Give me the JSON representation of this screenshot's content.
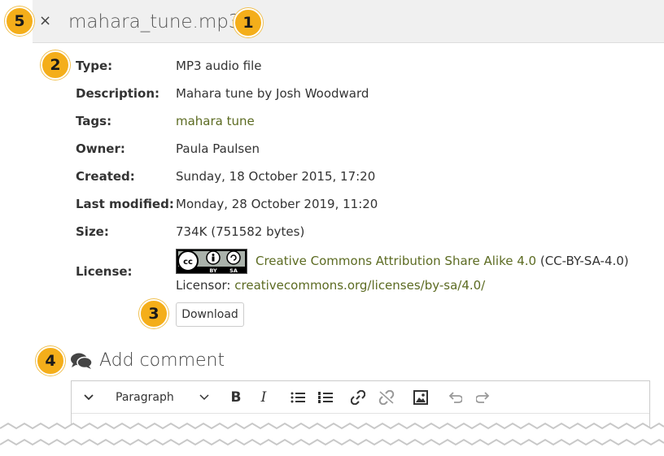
{
  "header": {
    "close_label": "×",
    "title": "mahara_tune.mp3"
  },
  "badges": [
    "5",
    "1",
    "2",
    "3",
    "4"
  ],
  "details": {
    "type_label": "Type:",
    "type_value": "MP3 audio file",
    "description_label": "Description:",
    "description_value": "Mahara tune by Josh Woodward",
    "tags_label": "Tags:",
    "tags_value": "mahara tune",
    "owner_label": "Owner:",
    "owner_value": "Paula Paulsen",
    "created_label": "Created:",
    "created_value": "Sunday, 18 October 2015, 17:20",
    "modified_label": "Last modified:",
    "modified_value": "Monday, 28 October 2019, 11:20",
    "size_label": "Size:",
    "size_value": "734K (751582 bytes)",
    "license_label": "License:",
    "license_link": "Creative Commons Attribution Share Alike 4.0",
    "license_code": "(CC-BY-SA-4.0)",
    "licensor_label": "Licensor:",
    "licensor_link": "creativecommons.org/licenses/by-sa/4.0/"
  },
  "cc_logo_text": {
    "cc": "cc",
    "by": "BY",
    "sa": "SA"
  },
  "download_label": "Download",
  "comment": {
    "heading": "Add comment",
    "toolbar": {
      "block_format": "Paragraph",
      "icons": [
        "chevron-down-icon",
        "bold-icon",
        "italic-icon",
        "bullet-list-icon",
        "numbered-list-icon",
        "link-icon",
        "unlink-icon",
        "image-icon",
        "undo-icon",
        "redo-icon"
      ]
    }
  },
  "colors": {
    "badge": "#f4ae1a",
    "link": "#5c6b22",
    "header_bg": "#f0f0f0"
  }
}
